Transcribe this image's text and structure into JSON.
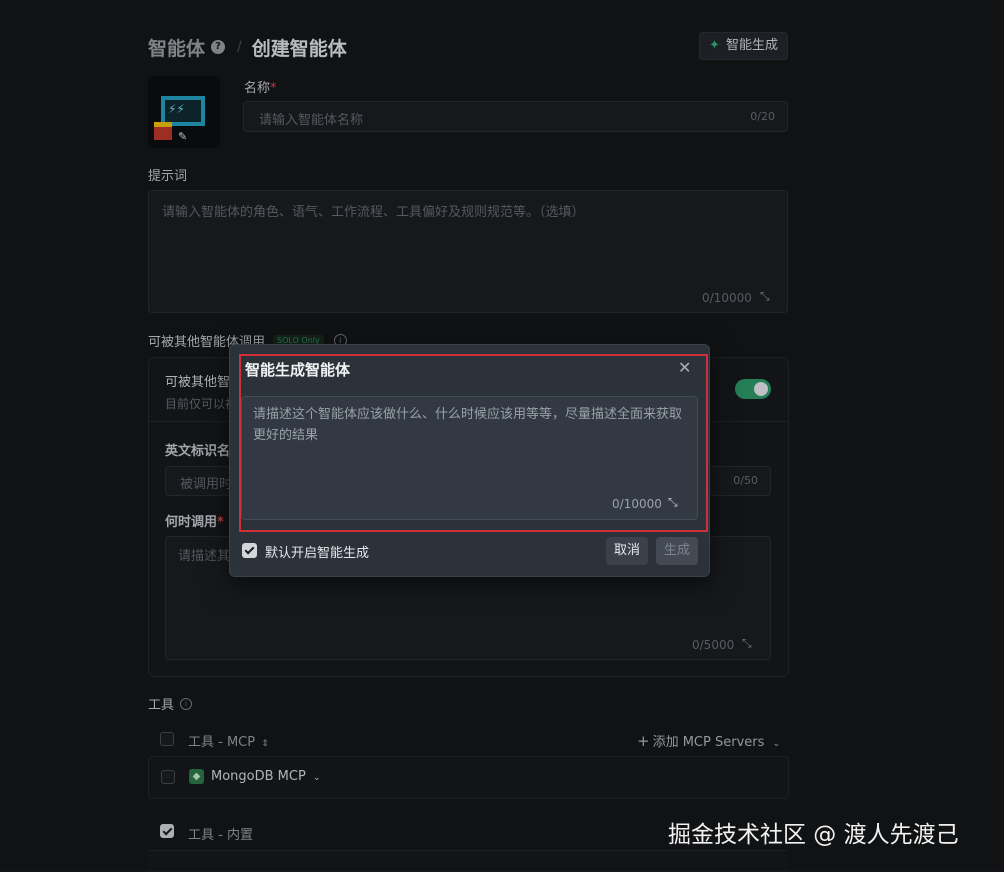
{
  "header": {
    "breadcrumb_root": "智能体",
    "breadcrumb_sep": "/",
    "page_title": "创建智能体",
    "smart_generate_button": "智能生成"
  },
  "name_field": {
    "label": "名称",
    "required_mark": "*",
    "placeholder": "请输入智能体名称",
    "counter": "0/20"
  },
  "prompt_field": {
    "label": "提示词",
    "placeholder": "请输入智能体的角色、语气、工作流程、工具偏好及规则规范等。（选填）",
    "counter": "0/10000"
  },
  "callable": {
    "label": "可被其他智能体调用",
    "badge": "SOLO Only",
    "toggle_label": "可被其他智",
    "toggle_desc": "目前仅可以被",
    "toggle_on": true,
    "english_id_label": "英文标识名",
    "english_id_placeholder": "被调用时",
    "english_id_counter": "0/50",
    "when_label": "何时调用",
    "when_placeholder": "请描述其",
    "when_counter": "0/5000"
  },
  "tools": {
    "label": "工具",
    "mcp_section": "工具 - MCP",
    "add_mcp": "添加 MCP Servers",
    "mcp_item": "MongoDB MCP",
    "builtin_section": "工具 - 内置"
  },
  "modal": {
    "title": "智能生成智能体",
    "placeholder": "请描述这个智能体应该做什么、什么时候应该用等等，尽量描述全面来获取更好的结果",
    "counter": "0/10000",
    "default_on_label": "默认开启智能生成",
    "default_on_checked": true,
    "cancel_button": "取消",
    "generate_button": "生成"
  },
  "watermark": "掘金技术社区 @ 渡人先渡己",
  "colors": {
    "accent_green": "#2e9a6b",
    "highlight_red": "#d0303a"
  },
  "icons": {
    "help": "question-circle-icon",
    "sparkle": "sparkle-icon",
    "expand": "expand-icon",
    "close": "close-icon",
    "info": "info-icon",
    "plus": "plus-icon",
    "sort": "sort-icon",
    "chevron": "chevron-down-icon",
    "edit": "pencil-icon"
  }
}
